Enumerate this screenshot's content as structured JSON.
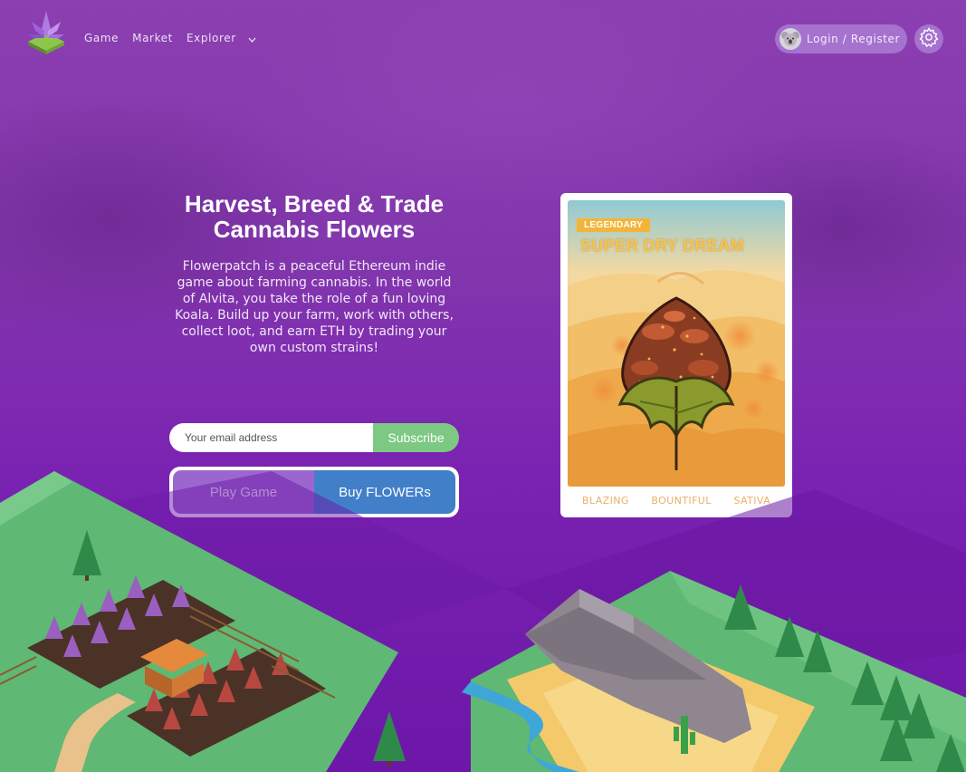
{
  "nav": {
    "links": [
      "Game",
      "Market",
      "Explorer"
    ],
    "login_label": "Login / Register"
  },
  "hero": {
    "title": "Harvest, Breed & Trade Cannabis Flowers",
    "description": "Flowerpatch is a peaceful Ethereum indie game about farming cannabis. In the world of Alvita, you take the role of a fun loving Koala. Build up your farm, work with others, collect loot, and earn ETH by trading your own custom strains!"
  },
  "signup": {
    "email_placeholder": "Your email address",
    "subscribe_label": "Subscribe"
  },
  "cta": {
    "play_label": "Play Game",
    "buy_label": "Buy FLOWERs"
  },
  "card": {
    "rarity": "LEGENDARY",
    "name": "SUPER DRY DREAM",
    "traits": [
      "BLAZING",
      "BOUNTIFUL",
      "SATIVA"
    ]
  },
  "icons": [
    "logo-icon",
    "chevron-down-icon",
    "koala-avatar-icon",
    "gear-icon"
  ],
  "colors": {
    "background": "#8236ad",
    "subscribe": "#7dc883",
    "play": "#9b67cf",
    "buy": "#417fc9",
    "rarity": "#f2b53a",
    "trait_text": "#e8b06a"
  }
}
